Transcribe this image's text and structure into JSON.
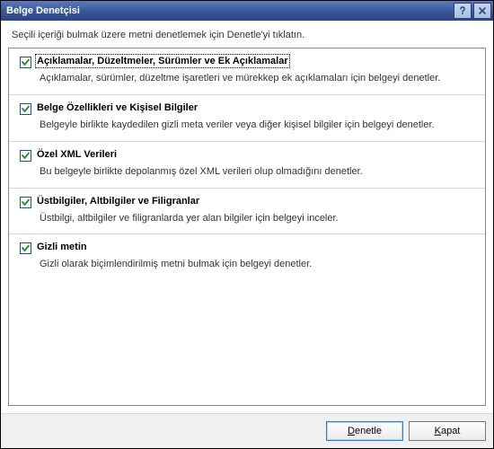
{
  "window": {
    "title": "Belge Denetçisi"
  },
  "instruction": "Seçili içeriği bulmak üzere metni denetlemek için Denetle'yi tıklatın.",
  "items": [
    {
      "checked": true,
      "focused": true,
      "title": "Açıklamalar, Düzeltmeler, Sürümler ve Ek Açıklamalar",
      "desc": "Açıklamalar, sürümler, düzeltme işaretleri ve mürekkep ek açıklamaları için belgeyi denetler."
    },
    {
      "checked": true,
      "focused": false,
      "title": "Belge Özellikleri ve Kişisel Bilgiler",
      "desc": "Belgeyle birlikte kaydedilen gizli meta veriler veya diğer kişisel bilgiler için belgeyi denetler."
    },
    {
      "checked": true,
      "focused": false,
      "title": "Özel XML Verileri",
      "desc": "Bu belgeyle birlikte depolanmış özel XML verileri olup olmadığını denetler."
    },
    {
      "checked": true,
      "focused": false,
      "title": "Üstbilgiler, Altbilgiler ve Filigranlar",
      "desc": "Üstbilgi, altbilgiler ve filigranlarda yer alan bilgiler için belgeyi inceler."
    },
    {
      "checked": true,
      "focused": false,
      "title": "Gizli metin",
      "desc": "Gizli olarak biçimlendirilmiş metni bulmak için belgeyi denetler."
    }
  ],
  "buttons": {
    "inspect": {
      "pre": "",
      "acc": "D",
      "post": "enetle"
    },
    "close": {
      "pre": "",
      "acc": "K",
      "post": "apat"
    }
  }
}
